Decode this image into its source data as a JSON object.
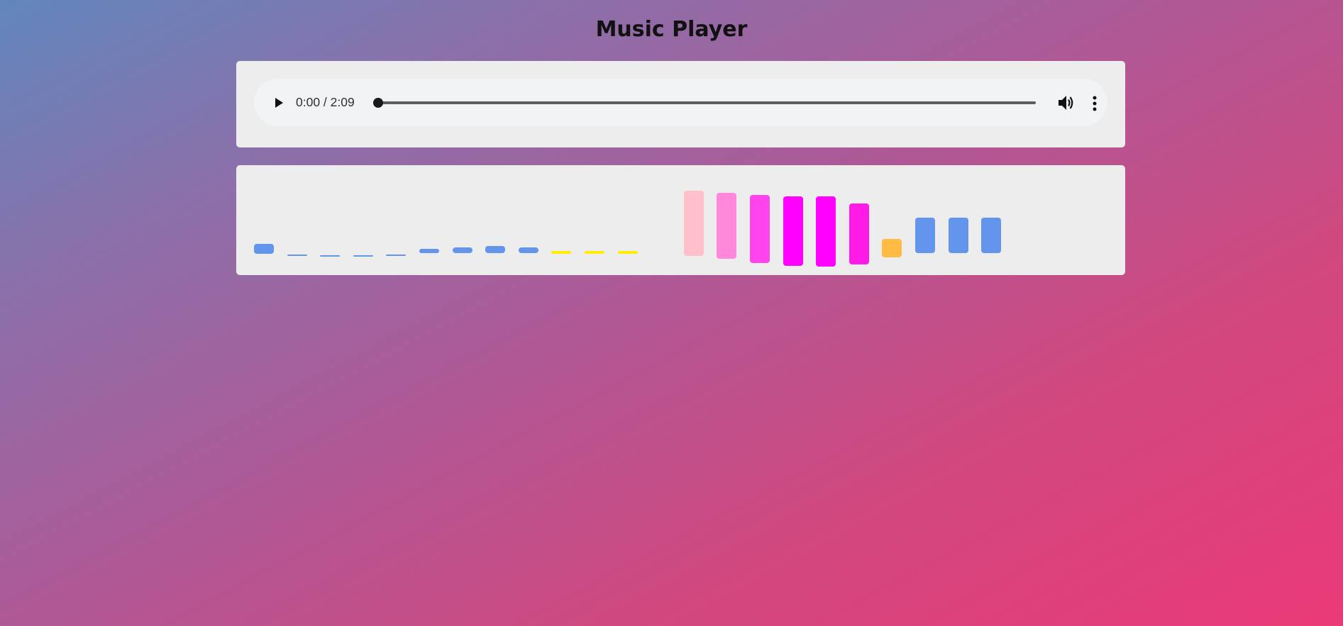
{
  "header": {
    "title": "Music Player"
  },
  "player": {
    "time_display": "0:00 / 2:09",
    "progress": 0,
    "icons": {
      "play": "play-icon",
      "volume": "volume-icon",
      "menu": "more-vertical-icon"
    }
  },
  "visualizer": {
    "bars": [
      {
        "color": "#6495ed"
      },
      {
        "color": "#6495ed"
      },
      {
        "color": "#6495ed"
      },
      {
        "color": "#6495ed"
      },
      {
        "color": "#6495ed"
      },
      {
        "color": "#6495ed"
      },
      {
        "color": "#6495ed"
      },
      {
        "color": "#6495ed"
      },
      {
        "color": "#6495ed"
      },
      {
        "color": "#ffee00"
      },
      {
        "color": "#ffee00"
      },
      {
        "color": "#ffee00"
      },
      {
        "color": "#ededee"
      },
      {
        "color": "#ffc0cb"
      },
      {
        "color": "#ff88dd"
      },
      {
        "color": "#ff44ee"
      },
      {
        "color": "#ff00ff"
      },
      {
        "color": "#ff00ff"
      },
      {
        "color": "#ff1ae8"
      },
      {
        "color": "#ffbb44"
      },
      {
        "color": "#6495ed"
      },
      {
        "color": "#6495ed"
      },
      {
        "color": "#6495ed"
      }
    ]
  }
}
